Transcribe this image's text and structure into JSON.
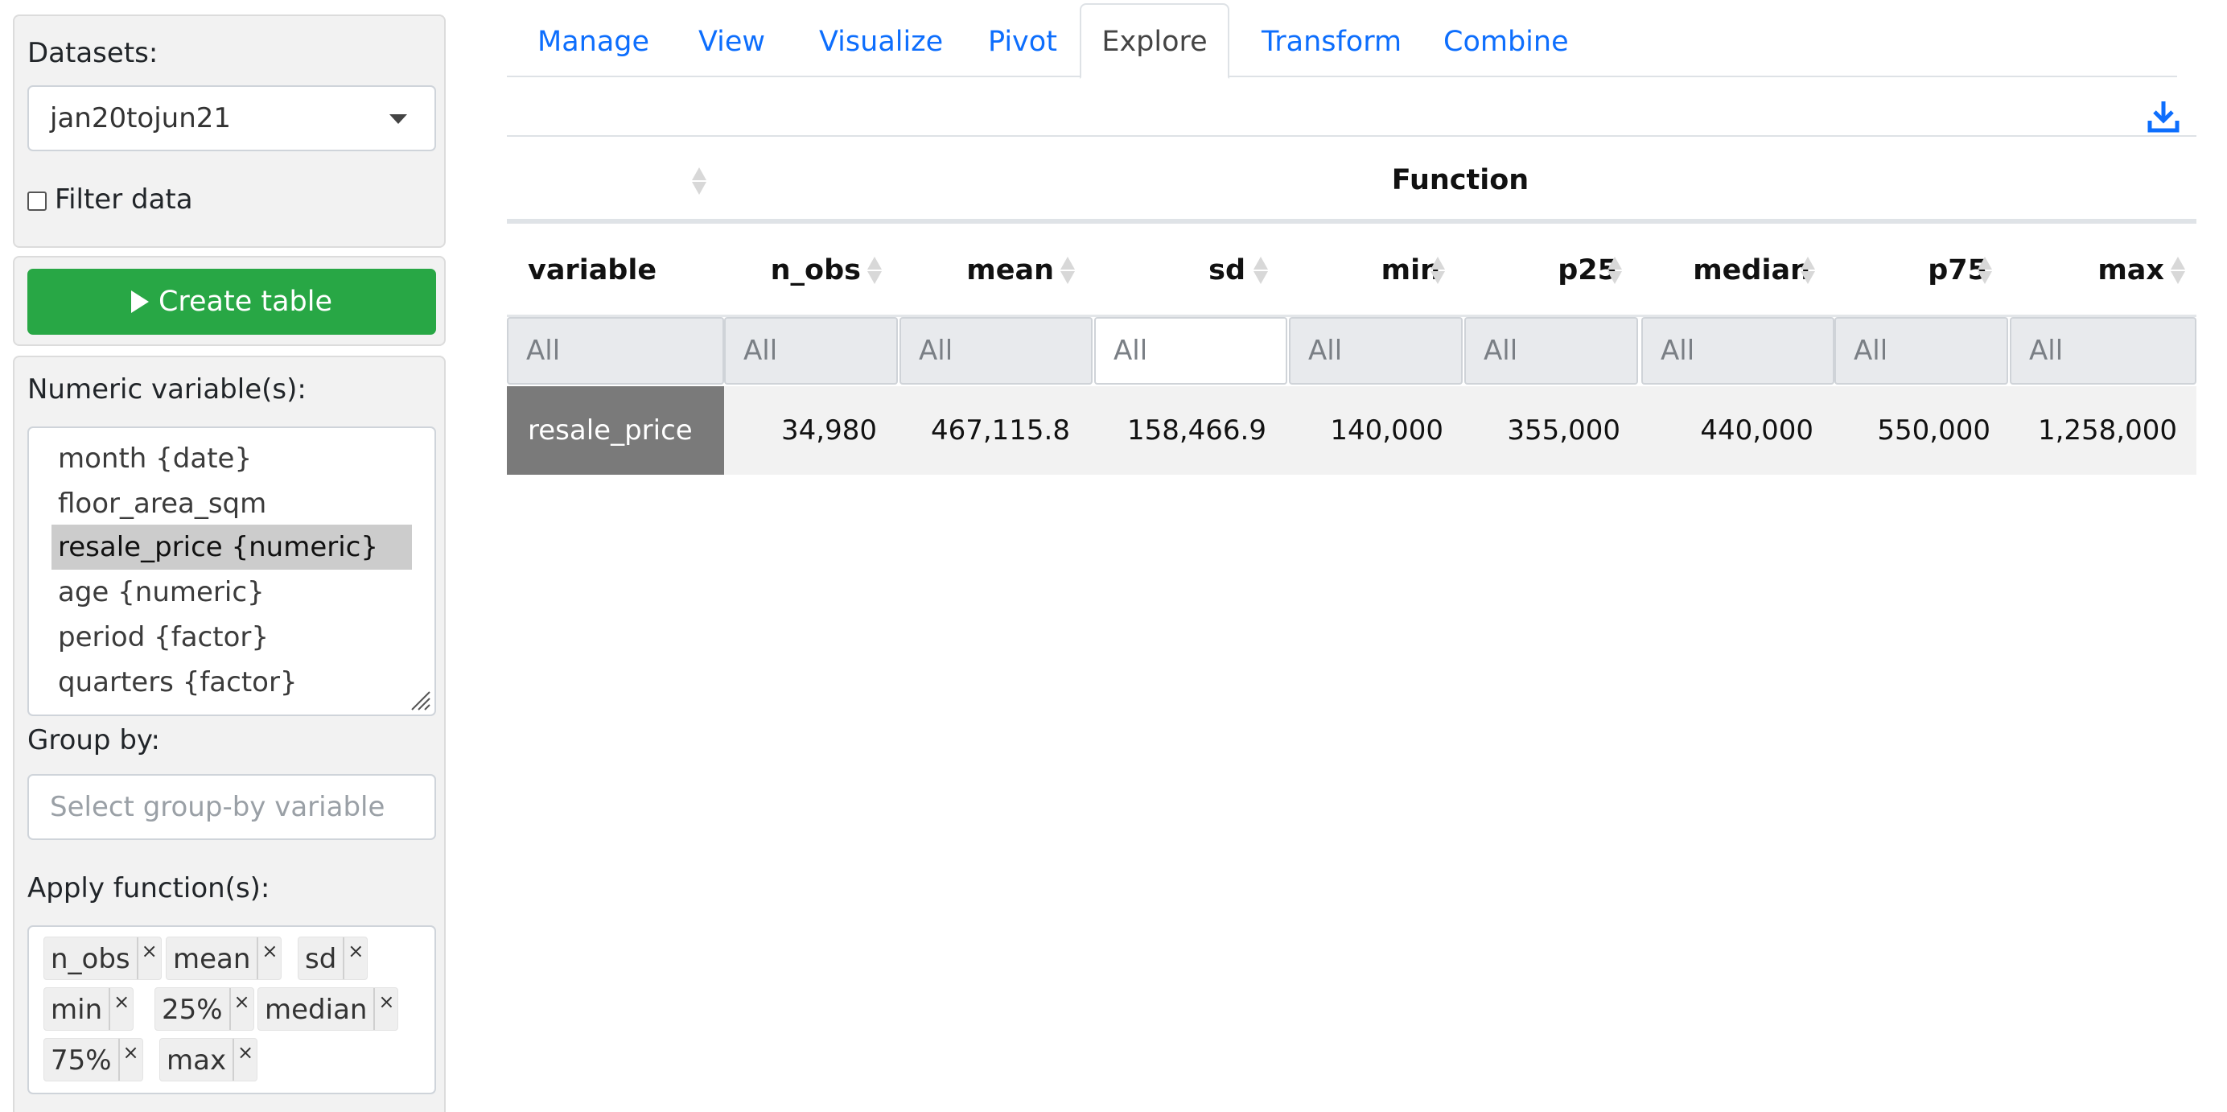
{
  "sidebar": {
    "datasets_label": "Datasets:",
    "dataset_value": "jan20tojun21",
    "filter_label": "Filter data",
    "create_button": "Create table",
    "numeric_label": "Numeric variable(s):",
    "numeric_options": [
      "month {date}",
      "floor_area_sqm {numeric}",
      "resale_price {numeric}",
      "age {numeric}",
      "period {factor}",
      "quarters {factor}"
    ],
    "selected_option": "resale_price {numeric}",
    "groupby_label": "Group by:",
    "groupby_placeholder": "Select group-by variable",
    "functions_label": "Apply function(s):",
    "functions": [
      "n_obs",
      "mean",
      "sd",
      "min",
      "25%",
      "median",
      "75%",
      "max"
    ]
  },
  "tabs": [
    "Manage",
    "View",
    "Visualize",
    "Pivot",
    "Explore",
    "Transform",
    "Combine"
  ],
  "active_tab": "Explore",
  "table": {
    "group_header": "Function",
    "columns": [
      "variable",
      "n_obs",
      "mean",
      "sd",
      "min",
      "p25",
      "median",
      "p75",
      "max"
    ],
    "filters": [
      "All",
      "All",
      "All",
      "All",
      "All",
      "All",
      "All",
      "All",
      "All"
    ],
    "rows": [
      [
        "resale_price",
        "34,980",
        "467,115.8",
        "158,466.9",
        "140,000",
        "355,000",
        "440,000",
        "550,000",
        "1,258,000"
      ]
    ]
  },
  "colors": {
    "accent": "#0d6efd",
    "button_green": "#28a745",
    "selected_cell": "#7a7a7a"
  },
  "icons": {
    "download": "download-icon",
    "sort": "sort-icon",
    "play": "play-icon"
  }
}
